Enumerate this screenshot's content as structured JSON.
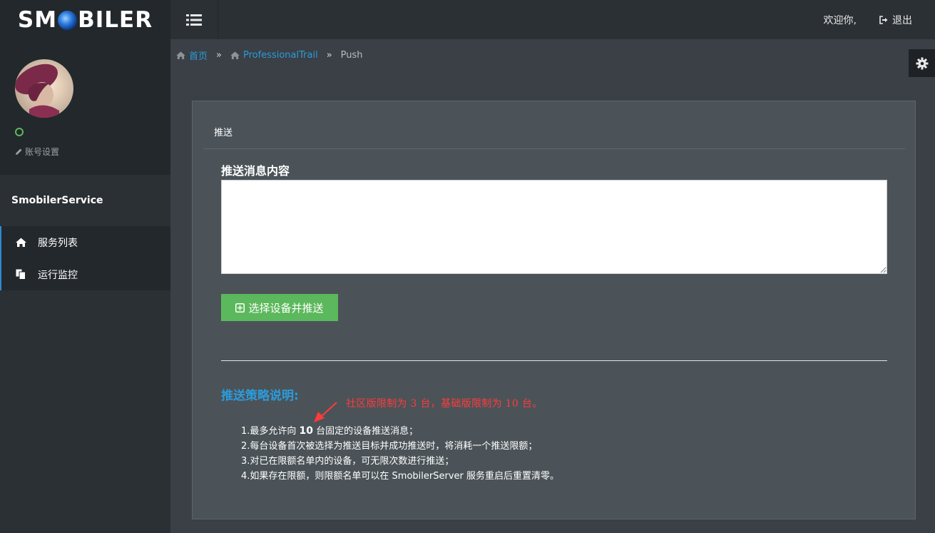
{
  "header": {
    "logo_prefix": "SM",
    "logo_suffix": "BILER",
    "welcome": "欢迎你,",
    "logout": "退出"
  },
  "sidebar": {
    "account_setting": "账号设置",
    "service_name": "SmobilerService",
    "items": [
      {
        "label": "服务列表",
        "icon": "home-icon"
      },
      {
        "label": "运行监控",
        "icon": "copy-icon"
      }
    ]
  },
  "breadcrumb": {
    "home": "首页",
    "app": "ProfessionalTrail",
    "current": "Push",
    "separator": "»"
  },
  "panel": {
    "title": "推送",
    "field_label": "推送消息内容",
    "textarea_value": "",
    "push_button": "选择设备并推送",
    "policy_title": "推送策略说明:",
    "annotation": "社区版限制为 3 台，基础版限制为 10 台。",
    "rules": {
      "r1_pre": "1.最多允许向 ",
      "r1_num": "10",
      "r1_post": " 台固定的设备推送消息；",
      "r2": "2.每台设备首次被选择为推送目标并成功推送时，将消耗一个推送限额；",
      "r3": "3.对已在限额名单内的设备，可无限次数进行推送；",
      "r4": "4.如果存在限额，则限额名单可以在 SmobilerServer 服务重启后重置清零。"
    }
  },
  "colors": {
    "accent_blue": "#2b9bdc",
    "success_green": "#5cb85c",
    "annotation_red": "#ff3b3b"
  }
}
